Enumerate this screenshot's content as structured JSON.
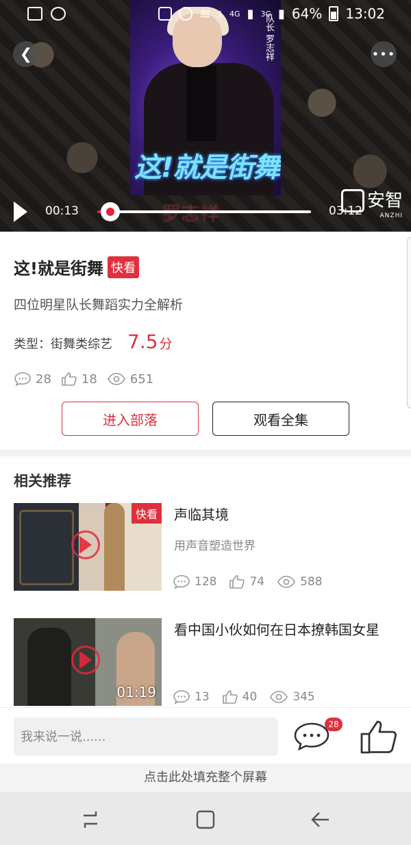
{
  "status_bar": {
    "battery": "64%",
    "time": "13:02",
    "network_badge_1": "4G",
    "network_badge_2": "3G",
    "sim": "1"
  },
  "video": {
    "poster_logo": "这!就是街舞",
    "poster_tag": "队长 罗志祥",
    "caption": "罗志祥",
    "current_time": "00:13",
    "total_time": "03:12",
    "progress": 0.06,
    "watermark": "安智",
    "watermark_sub": "ANZHI"
  },
  "show": {
    "title": "这!就是街舞",
    "badge": "快看",
    "subtitle": "四位明星队长舞蹈实力全解析",
    "type_label": "类型：街舞类综艺",
    "score": "7.5",
    "score_unit": "分",
    "comments": "28",
    "likes": "18",
    "views": "651",
    "tribe_button": "进入部落",
    "watch_all_button": "观看全集"
  },
  "related": {
    "heading": "相关推荐",
    "items": [
      {
        "title": "声临其境",
        "subtitle": "用声音塑造世界",
        "badge": "快看",
        "duration": "",
        "comments": "128",
        "likes": "74",
        "views": "588"
      },
      {
        "title": "看中国小伙如何在日本撩韩国女星",
        "subtitle": "",
        "badge": "",
        "duration": "01:19",
        "comments": "13",
        "likes": "40",
        "views": "345"
      }
    ]
  },
  "input_bar": {
    "placeholder": "我来说一说......",
    "comment_count": "28"
  },
  "fill_hint": "点击此处填充整个屏幕",
  "colors": {
    "accent": "#e0303e",
    "score": "#d8343f"
  }
}
